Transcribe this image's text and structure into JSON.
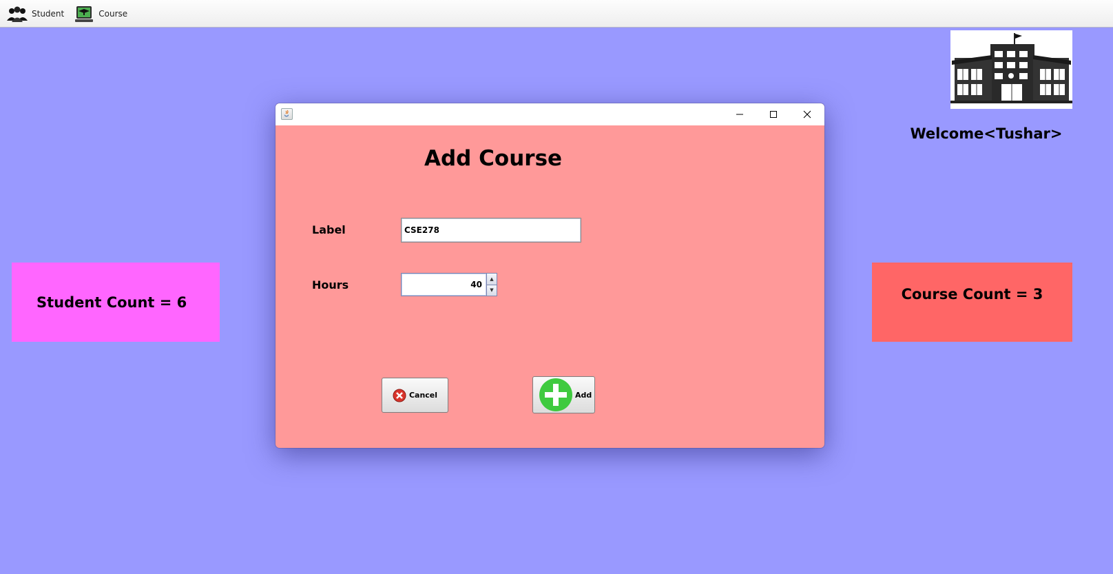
{
  "menubar": {
    "items": [
      {
        "label": "Student",
        "icon": "students-group-icon"
      },
      {
        "label": "Course",
        "icon": "course-laptop-icon"
      }
    ]
  },
  "header": {
    "welcome": "Welcome<Tushar>",
    "logo_icon": "school-building-icon"
  },
  "stats": {
    "student_count": "Student Count = 6",
    "course_count": "Course Count = 3"
  },
  "dialog": {
    "title": "Add Course",
    "window_icon": "java-cup-icon",
    "fields": {
      "label_caption": "Label",
      "label_value": "CSE278",
      "hours_caption": "Hours",
      "hours_value": "40"
    },
    "buttons": {
      "cancel": "Cancel",
      "add": "Add"
    }
  },
  "colors": {
    "background": "#9999ff",
    "dialog": "#ff9999",
    "student_box": "#ff66ff",
    "course_box": "#ff6666"
  }
}
